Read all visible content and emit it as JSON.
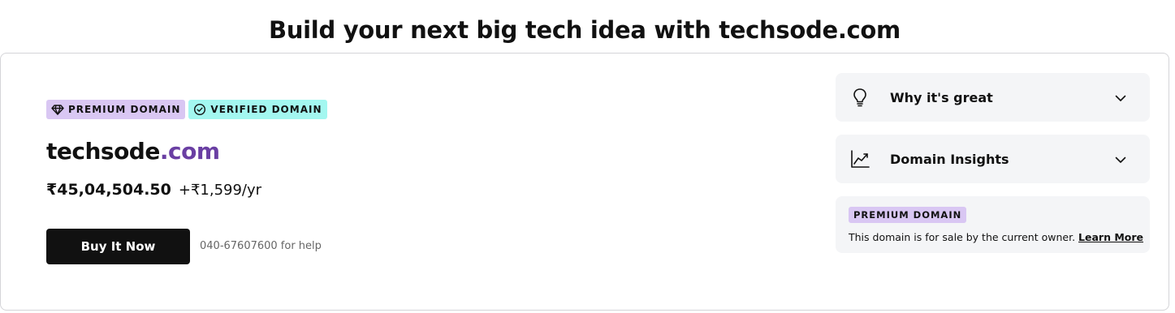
{
  "headline": "Build your next big tech idea with techsode.com",
  "badges": {
    "premium": "PREMIUM DOMAIN",
    "verified": "VERIFIED DOMAIN"
  },
  "domain": {
    "name": "techsode",
    "tld": ".com"
  },
  "price": {
    "amount": "₹45,04,504.50",
    "renewal": "+₹1,599/yr"
  },
  "buy_button": "Buy It Now",
  "help_text": "040-67607600 for help",
  "accordions": [
    {
      "label": "Why it's great",
      "icon": "lightbulb-icon"
    },
    {
      "label": "Domain Insights",
      "icon": "trend-chart-icon"
    }
  ],
  "info_box": {
    "badge": "PREMIUM DOMAIN",
    "text": "This domain is for sale by the current owner.",
    "link": "Learn More"
  },
  "colors": {
    "premium_badge": "#d9c7f3",
    "verified_badge": "#a3f7f0",
    "tld": "#6a3fa3",
    "button": "#111111"
  }
}
